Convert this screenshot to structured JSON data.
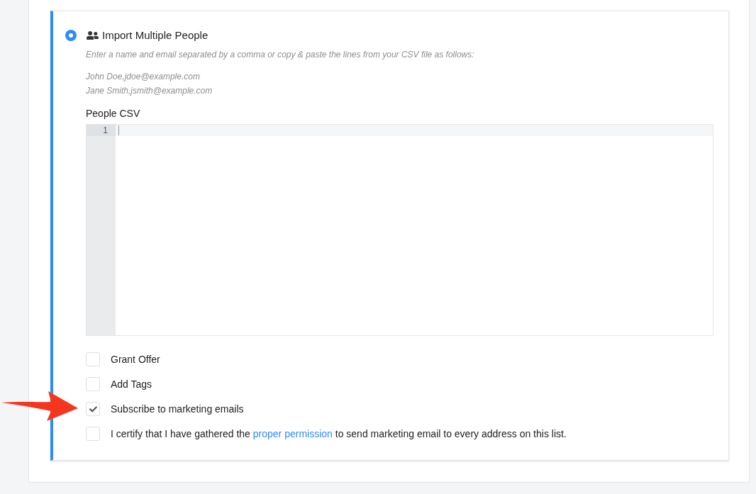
{
  "option": {
    "title": "Import Multiple People",
    "selected": true,
    "hint": "Enter a name and email separated by a comma or copy & paste the lines from your CSV file as follows:",
    "examples": [
      "John Doe,jdoe@example.com",
      "Jane Smith,jsmith@example.com"
    ],
    "editor": {
      "label": "People CSV",
      "line_numbers": [
        "1"
      ]
    },
    "checkboxes": [
      {
        "label": "Grant Offer",
        "checked": false
      },
      {
        "label": "Add Tags",
        "checked": false
      },
      {
        "label": "Subscribe to marketing emails",
        "checked": true
      },
      {
        "label": "I certify that I have gathered the ",
        "link": "proper permission",
        "label_after": " to send marketing email to every address on this list.",
        "checked": false
      }
    ]
  }
}
